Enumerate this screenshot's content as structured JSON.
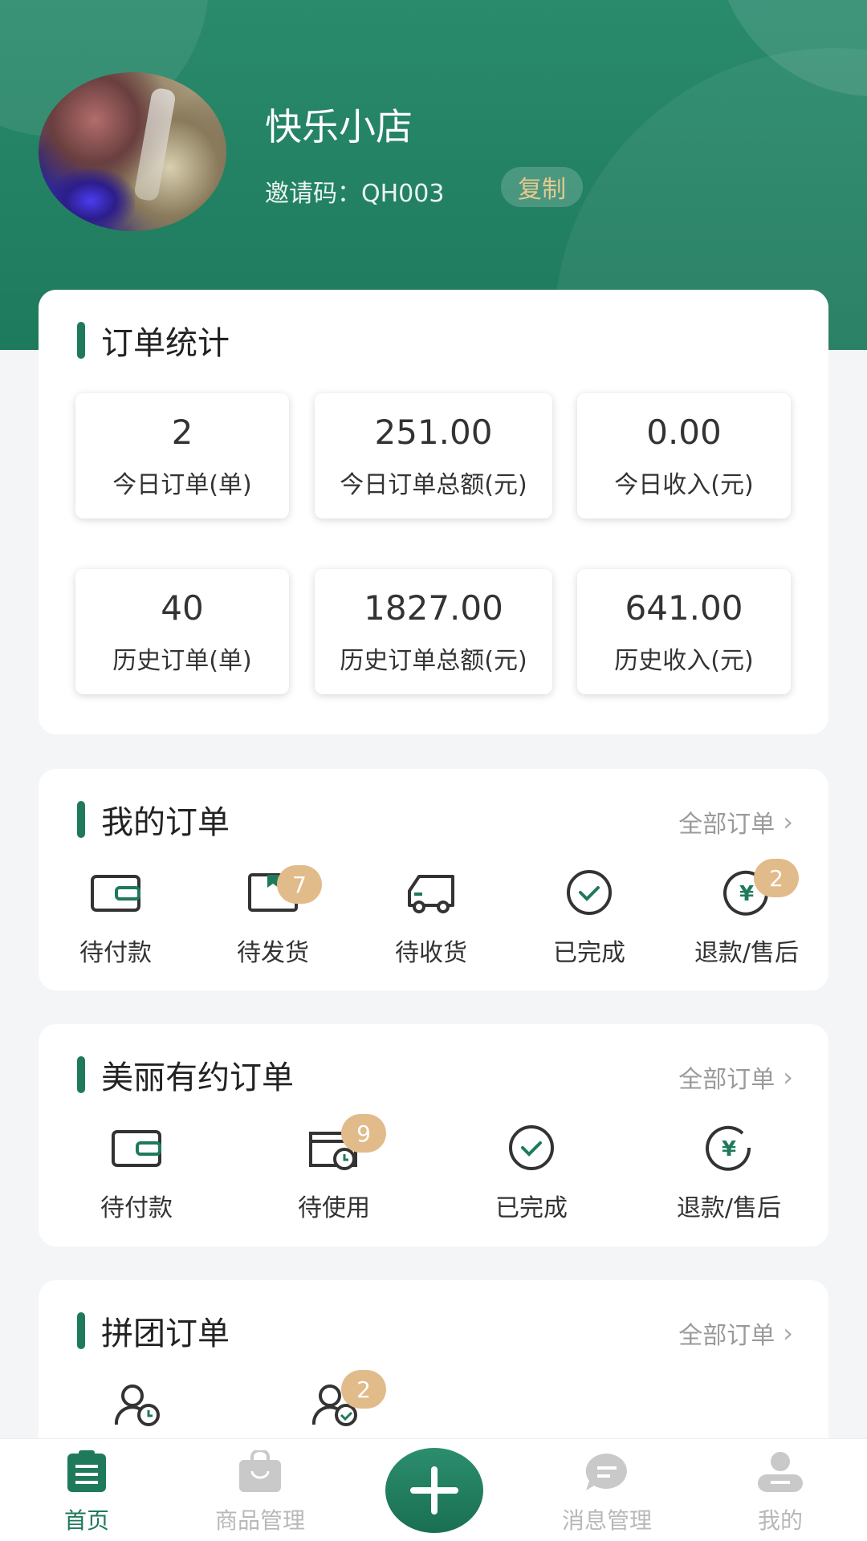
{
  "header": {
    "shop_name": "快乐小店",
    "invite_label": "邀请码：",
    "invite_code": "QH003",
    "copy_label": "复制"
  },
  "stats": {
    "title": "订单统计",
    "items": [
      {
        "value": "2",
        "label": "今日订单(单)"
      },
      {
        "value": "251.00",
        "label": "今日订单总额(元)"
      },
      {
        "value": "0.00",
        "label": "今日收入(元)"
      },
      {
        "value": "40",
        "label": "历史订单(单)"
      },
      {
        "value": "1827.00",
        "label": "历史订单总额(元)"
      },
      {
        "value": "641.00",
        "label": "历史收入(元)"
      }
    ]
  },
  "my_orders": {
    "title": "我的订单",
    "all_label": "全部订单",
    "items": [
      {
        "label": "待付款",
        "icon": "wallet-icon",
        "badge": ""
      },
      {
        "label": "待发货",
        "icon": "package-icon",
        "badge": "7"
      },
      {
        "label": "待收货",
        "icon": "truck-icon",
        "badge": ""
      },
      {
        "label": "已完成",
        "icon": "check-circle-icon",
        "badge": ""
      },
      {
        "label": "退款/售后",
        "icon": "refund-icon",
        "badge": "2"
      }
    ]
  },
  "beauty_orders": {
    "title": "美丽有约订单",
    "all_label": "全部订单",
    "items": [
      {
        "label": "待付款",
        "icon": "wallet-icon",
        "badge": ""
      },
      {
        "label": "待使用",
        "icon": "calendar-clock-icon",
        "badge": "9"
      },
      {
        "label": "已完成",
        "icon": "check-circle-icon",
        "badge": ""
      },
      {
        "label": "退款/售后",
        "icon": "refund-icon",
        "badge": ""
      }
    ]
  },
  "group_orders": {
    "title": "拼团订单",
    "all_label": "全部订单",
    "items": [
      {
        "icon": "group-clock-icon",
        "badge": ""
      },
      {
        "icon": "group-check-icon",
        "badge": "2"
      }
    ]
  },
  "tabbar": {
    "items": [
      {
        "label": "首页",
        "icon": "home-clipboard-icon",
        "active": true
      },
      {
        "label": "商品管理",
        "icon": "bag-icon",
        "active": false
      },
      {
        "label": "",
        "icon": "plus-icon",
        "active": false
      },
      {
        "label": "消息管理",
        "icon": "chat-icon",
        "active": false
      },
      {
        "label": "我的",
        "icon": "user-icon",
        "active": false
      }
    ]
  },
  "colors": {
    "primary": "#1f7a5c",
    "badge": "#e2bb8a",
    "copy_text": "#e8c98e"
  }
}
